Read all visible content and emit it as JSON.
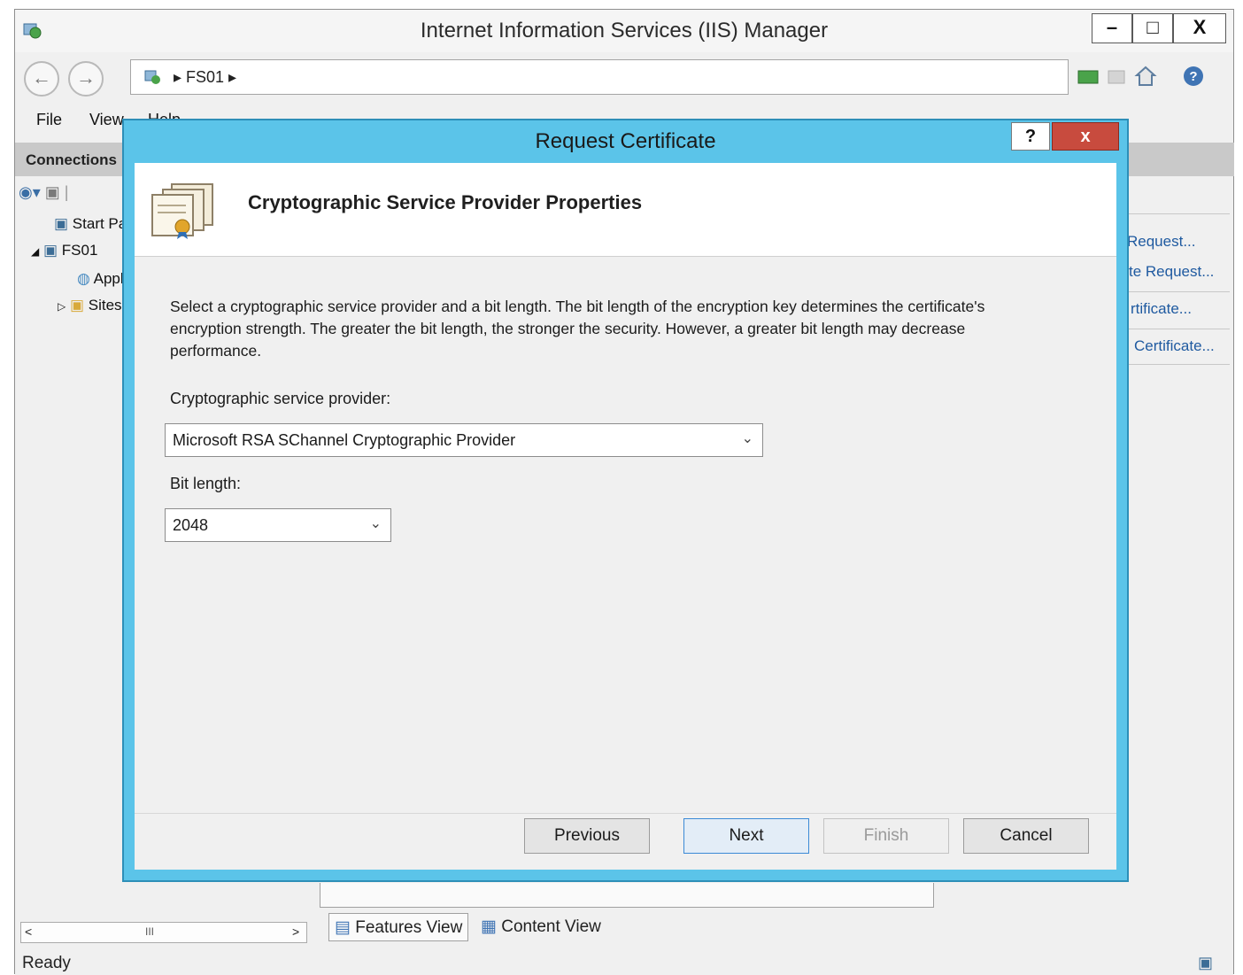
{
  "window": {
    "title": "Internet Information Services (IIS) Manager",
    "minimize": "–",
    "maximize": "□",
    "close": "X"
  },
  "address": {
    "path": "▸  FS01  ▸"
  },
  "menu": [
    "File",
    "View",
    "Help"
  ],
  "connections": {
    "header": "Connections",
    "tree": [
      {
        "label": "Start Page"
      },
      {
        "label": "FS01"
      },
      {
        "label": "Application Pools"
      },
      {
        "label": "Sites"
      }
    ],
    "scroll_label": "III"
  },
  "actions": {
    "items": [
      "Request...",
      "te Request...",
      "rtificate...",
      "Certificate..."
    ]
  },
  "view_tabs": {
    "features": "Features View",
    "content": "Content View"
  },
  "status": {
    "text": "Ready"
  },
  "dialog": {
    "title": "Request Certificate",
    "help": "?",
    "close": "x",
    "header_title": "Cryptographic Service Provider Properties",
    "description": "Select a cryptographic service provider and a bit length. The bit length of the encryption key determines the certificate's encryption strength. The greater the bit length, the stronger the security. However, a greater bit length may decrease performance.",
    "csp_label": "Cryptographic service provider:",
    "csp_value": "Microsoft RSA SChannel Cryptographic Provider",
    "bit_label": "Bit length:",
    "bit_value": "2048",
    "buttons": {
      "previous": "Previous",
      "next": "Next",
      "finish": "Finish",
      "cancel": "Cancel"
    }
  }
}
